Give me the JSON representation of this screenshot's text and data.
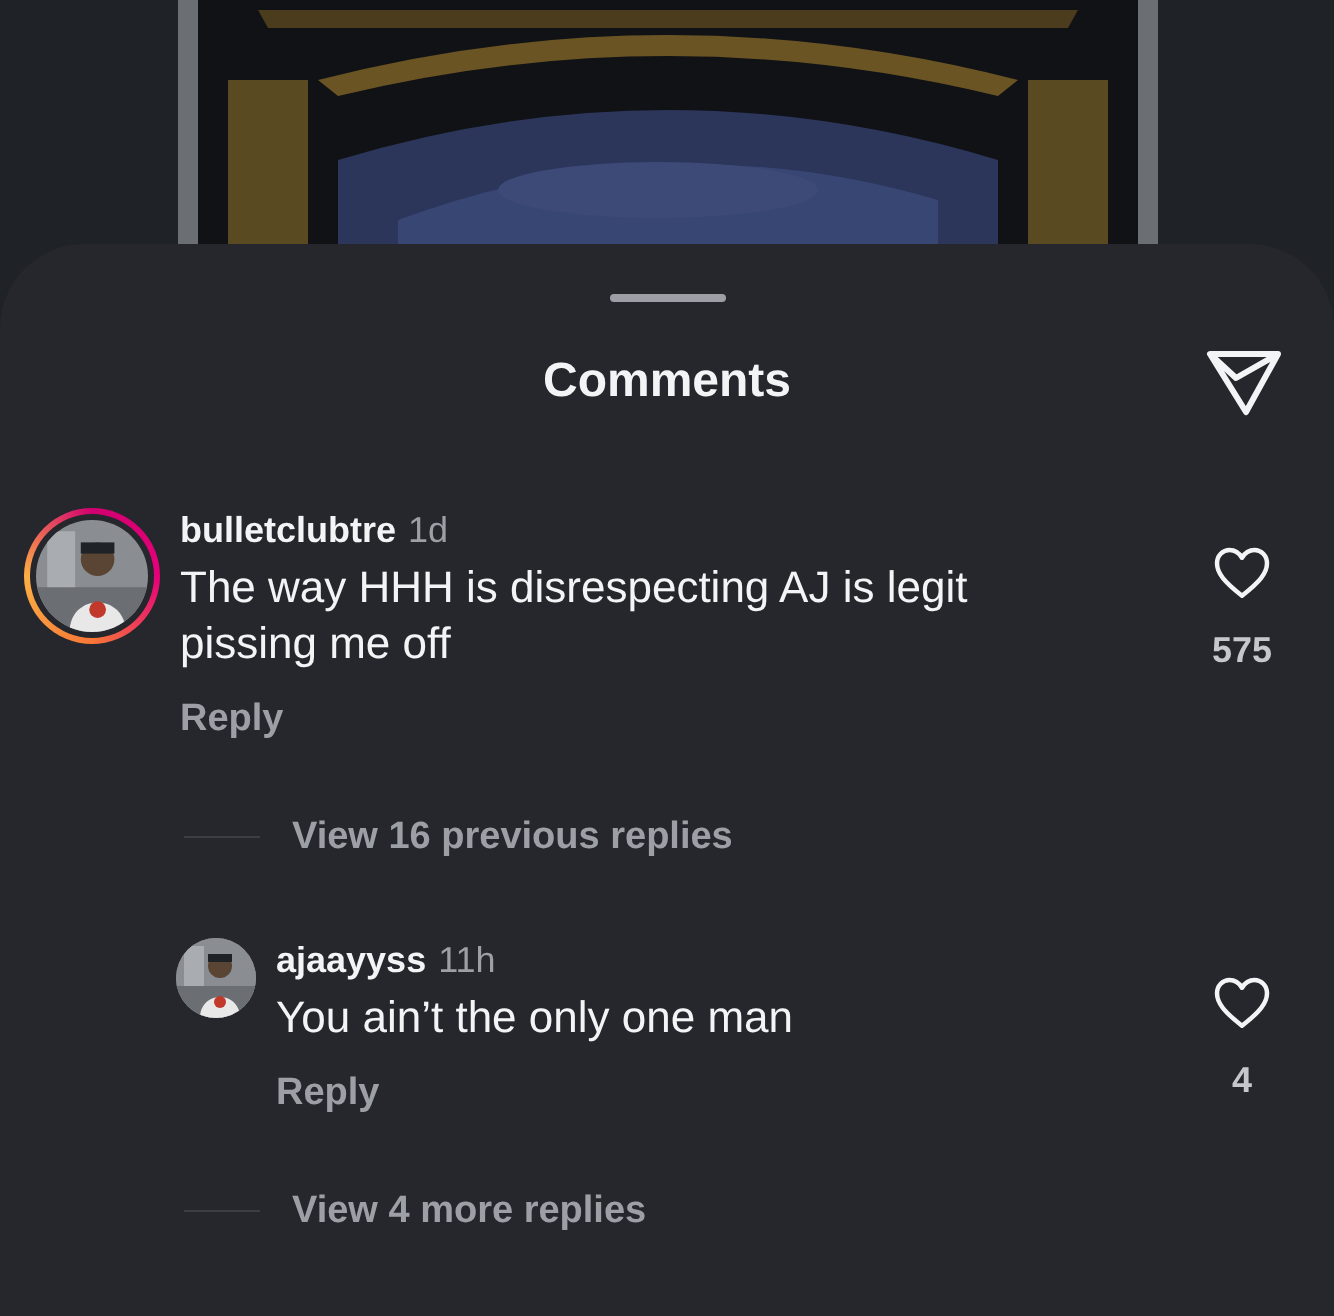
{
  "header": {
    "title": "Comments"
  },
  "comment": {
    "username": "bulletclubtre",
    "time": "1d",
    "text": "The way HHH is disrespecting AJ is legit pissing me off",
    "reply": "Reply",
    "likes": "575",
    "story": true
  },
  "view_previous": "View 16 previous replies",
  "replies": [
    {
      "username": "ajaayyss",
      "time": "11h",
      "text": "You ain’t the only one man",
      "reply": "Reply",
      "likes": "4",
      "story": false
    }
  ],
  "view_more": "View 4 more replies"
}
